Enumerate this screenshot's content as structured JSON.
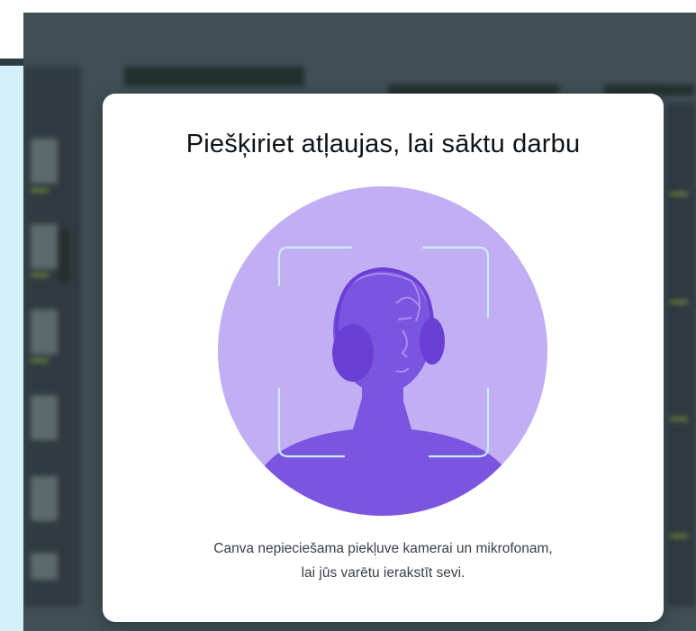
{
  "modal": {
    "title": "Piešķiriet atļaujas, lai sāktu darbu",
    "description_line1": "Canva nepieciešama piekļuve kamerai un mikrofonam,",
    "description_line2": "lai jūs varētu ierakstīt sevi.",
    "illustration_icon": "person-headphones-camera-frame-icon"
  },
  "colors": {
    "modal_bg": "#ffffff",
    "circle": "#c2aef2",
    "figure": "#7b55e0",
    "headphones": "#6a3fd6",
    "frame": "#c9ecf5",
    "left_panel": "#d3f0fb",
    "backdrop": "#3f4f55"
  }
}
